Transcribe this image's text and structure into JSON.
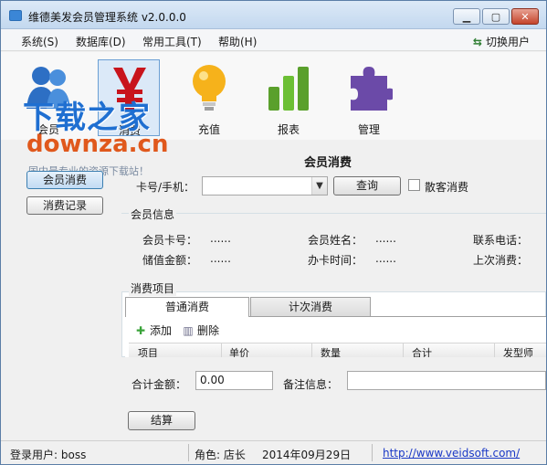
{
  "window": {
    "title": "维德美发会员管理系统 v2.0.0.0",
    "minimize": "▁",
    "maximize": "▢",
    "close": "✕"
  },
  "menu": {
    "items": [
      "系统(S)",
      "数据库(D)",
      "常用工具(T)",
      "帮助(H)"
    ],
    "switch_user": "切换用户",
    "switch_icon": "⇆"
  },
  "toolbar": {
    "items": [
      {
        "label": "会员",
        "icon": "members-icon"
      },
      {
        "label": "消费",
        "icon": "yen-icon",
        "selected": true
      },
      {
        "label": "充值",
        "icon": "lightbulb-icon"
      },
      {
        "label": "报表",
        "icon": "bar-chart-icon"
      },
      {
        "label": "管理",
        "icon": "puzzle-icon"
      }
    ]
  },
  "watermark": {
    "line1": "下载之家",
    "line2": "downza.cn",
    "line3": "国内最专业的资源下载站！"
  },
  "sidebar": {
    "buttons": [
      "会员消费",
      "消费记录"
    ]
  },
  "main": {
    "title": "会员消费",
    "card_label": "卡号/手机：",
    "card_value": "",
    "query_button": "查询",
    "walkin_label": "散客消费",
    "member_info": {
      "title": "会员信息",
      "fields": [
        {
          "label": "会员卡号：",
          "value": "......"
        },
        {
          "label": "会员姓名：",
          "value": "......"
        },
        {
          "label": "联系电话：",
          "value": ""
        },
        {
          "label": "储值金额：",
          "value": "......"
        },
        {
          "label": "办卡时间：",
          "value": "......"
        },
        {
          "label": "上次消费：",
          "value": ""
        }
      ]
    },
    "items": {
      "title": "消费项目",
      "tabs": [
        "普通消费",
        "计次消费"
      ],
      "add_label": "添加",
      "delete_label": "删除",
      "columns": [
        "项目",
        "单价",
        "数量",
        "合计",
        "发型师"
      ]
    },
    "total_label": "合计金额：",
    "total_value": "0.00",
    "remark_label": "备注信息：",
    "remark_value": "",
    "checkout_button": "结算"
  },
  "status": {
    "user": "登录用户: boss",
    "role": "角色: 店长",
    "date": "2014年09月29日",
    "url": "http://www.veidsoft.com/"
  }
}
